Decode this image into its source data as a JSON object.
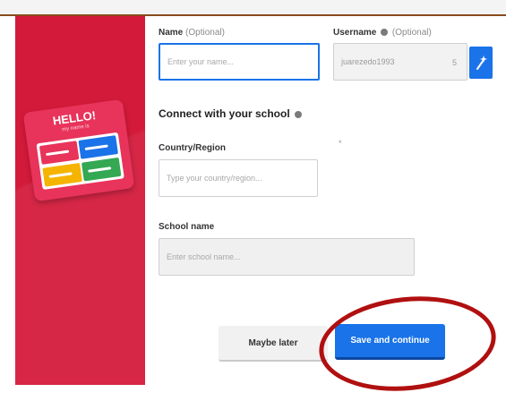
{
  "card": {
    "title": "HELLO!",
    "subtitle": "my name is"
  },
  "fields": {
    "name": {
      "label": "Name",
      "optional": "(Optional)",
      "placeholder": "Enter your name..."
    },
    "username": {
      "label": "Username",
      "optional": "(Optional)",
      "value": "juarezedo1993",
      "count": "5"
    },
    "connect_heading": "Connect with your school",
    "asterisk": "*",
    "country": {
      "label": "Country/Region",
      "placeholder": "Type your country/region..."
    },
    "school": {
      "label": "School name",
      "placeholder": "Enter school name..."
    }
  },
  "buttons": {
    "maybe_later": "Maybe later",
    "save_continue": "Save and continue"
  },
  "colors": {
    "accent": "#1a73e8",
    "panel": "#d31a3a",
    "highlight": "#b01010"
  }
}
